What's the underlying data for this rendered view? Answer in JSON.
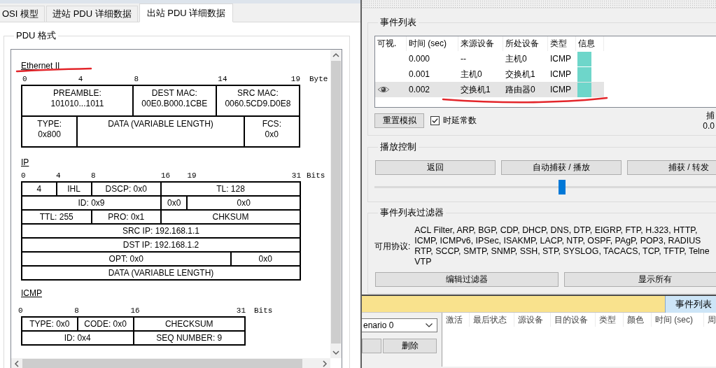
{
  "window": {
    "tabs": [
      {
        "label": "OSI 模型",
        "selected": false
      },
      {
        "label": "进站 PDU 详细数据",
        "selected": false
      },
      {
        "label": "出站 PDU 详细数据",
        "selected": true
      }
    ]
  },
  "pdu_format": {
    "title": "PDU 格式",
    "sections": [
      {
        "kind": "ethernet",
        "title": "Ethernet II",
        "marked": true,
        "ruler": [
          "0",
          "4",
          "8",
          "14",
          "19"
        ],
        "unit": "Byte",
        "rows": [
          [
            {
              "name": "PREAMBLE:",
              "value": "101010...1011",
              "colspan": 2
            },
            {
              "name": "DEST MAC:",
              "value": "00E0.B000.1CBE"
            },
            {
              "name": "SRC MAC:",
              "value": "0060.5CD9.D0E8",
              "colspan": 2
            }
          ],
          [
            {
              "name": "TYPE:",
              "value": "0x800"
            },
            {
              "name": "DATA (VARIABLE LENGTH)",
              "colspan": 3
            },
            {
              "name": "FCS:",
              "value": "0x0"
            }
          ]
        ]
      },
      {
        "kind": "ip",
        "title": "IP",
        "marked": false,
        "ruler": [
          "0",
          "4",
          "8",
          "16",
          "19",
          "31"
        ],
        "unit": "Bits",
        "rows": [
          [
            {
              "text": "4"
            },
            {
              "text": "IHL"
            },
            {
              "text": "DSCP: 0x0"
            },
            {
              "text": "TL: 128",
              "colspan": 3
            }
          ],
          [
            {
              "text": "ID: 0x9",
              "colspan": 3
            },
            {
              "text": "0x0"
            },
            {
              "text": "0x0",
              "colspan": 2
            }
          ],
          [
            {
              "text": "TTL: 255",
              "colspan": 2
            },
            {
              "text": "PRO: 0x1"
            },
            {
              "text": "CHKSUM",
              "colspan": 3
            }
          ],
          [
            {
              "text": "SRC IP: 192.168.1.1",
              "colspan": 6
            }
          ],
          [
            {
              "text": "DST IP: 192.168.1.2",
              "colspan": 6
            }
          ],
          [
            {
              "text": "OPT: 0x0",
              "colspan": 5
            },
            {
              "text": "0x0"
            }
          ],
          [
            {
              "text": "DATA (VARIABLE LENGTH)",
              "colspan": 6
            }
          ]
        ]
      },
      {
        "kind": "icmp",
        "title": "ICMP",
        "marked": false,
        "ruler": [
          "0",
          "8",
          "16",
          "31"
        ],
        "unit": "Bits",
        "rows": [
          [
            {
              "text": "TYPE: 0x0"
            },
            {
              "text": "CODE: 0x0"
            },
            {
              "text": "CHECKSUM"
            }
          ],
          [
            {
              "text": "ID: 0x4",
              "colspan": 2
            },
            {
              "text": "SEQ NUMBER: 9"
            }
          ]
        ]
      }
    ]
  },
  "event_list": {
    "title": "事件列表",
    "columns": [
      "可视.",
      "时间 (sec)",
      "来源设备",
      "所处设备",
      "类型",
      "信息"
    ],
    "rows": [
      {
        "time": "0.000",
        "source": "--",
        "at_device": "主机0",
        "type": "ICMP",
        "color": "#6ed6ca",
        "selected": false,
        "marked": false
      },
      {
        "time": "0.001",
        "source": "主机0",
        "at_device": "交换机1",
        "type": "ICMP",
        "color": "#6ed6ca",
        "selected": false,
        "marked": false
      },
      {
        "time": "0.002",
        "source": "交换机1",
        "at_device": "路由器0",
        "type": "ICMP",
        "color": "#6ed6ca",
        "selected": true,
        "marked": true
      }
    ],
    "reset_button": "重置模拟",
    "constant_delay": {
      "label": "时延常数",
      "checked": true
    },
    "side_info": {
      "label": "捕",
      "value": "0.0"
    }
  },
  "playback": {
    "title": "播放控制",
    "buttons": [
      "返回",
      "自动捕获 / 播放",
      "捕获 / 转发"
    ],
    "speed_slider": {
      "level": 0.55
    }
  },
  "filter": {
    "title": "事件列表过滤器",
    "protocols_label": "可用协议:",
    "protocol_lines": [
      "ACL Filter, ARP, BGP, CDP, DHCP, DNS, DTP, EIGRP, FTP, H.323, HTTP,",
      "ICMP, ICMPv6, IPSec, ISAKMP, LACP, NTP, OSPF, PAgP, POP3, RADIUS",
      "RTP, SCCP, SMTP, SNMP, SSH, STP, SYSLOG, TACACS, TCP, TFTP, Telne",
      "VTP"
    ],
    "buttons": [
      "编辑过滤器",
      "显示所有"
    ]
  },
  "bottom_bar": {
    "tab": {
      "label": "事件列表",
      "selected": true
    }
  },
  "scenario": {
    "dropdown": "enario 0",
    "delete_button": "删除"
  },
  "pdu_list": {
    "columns": [
      "激活",
      "最后状态",
      "源设备",
      "目的设备",
      "类型",
      "颜色",
      "时间 (sec)",
      "周"
    ]
  }
}
